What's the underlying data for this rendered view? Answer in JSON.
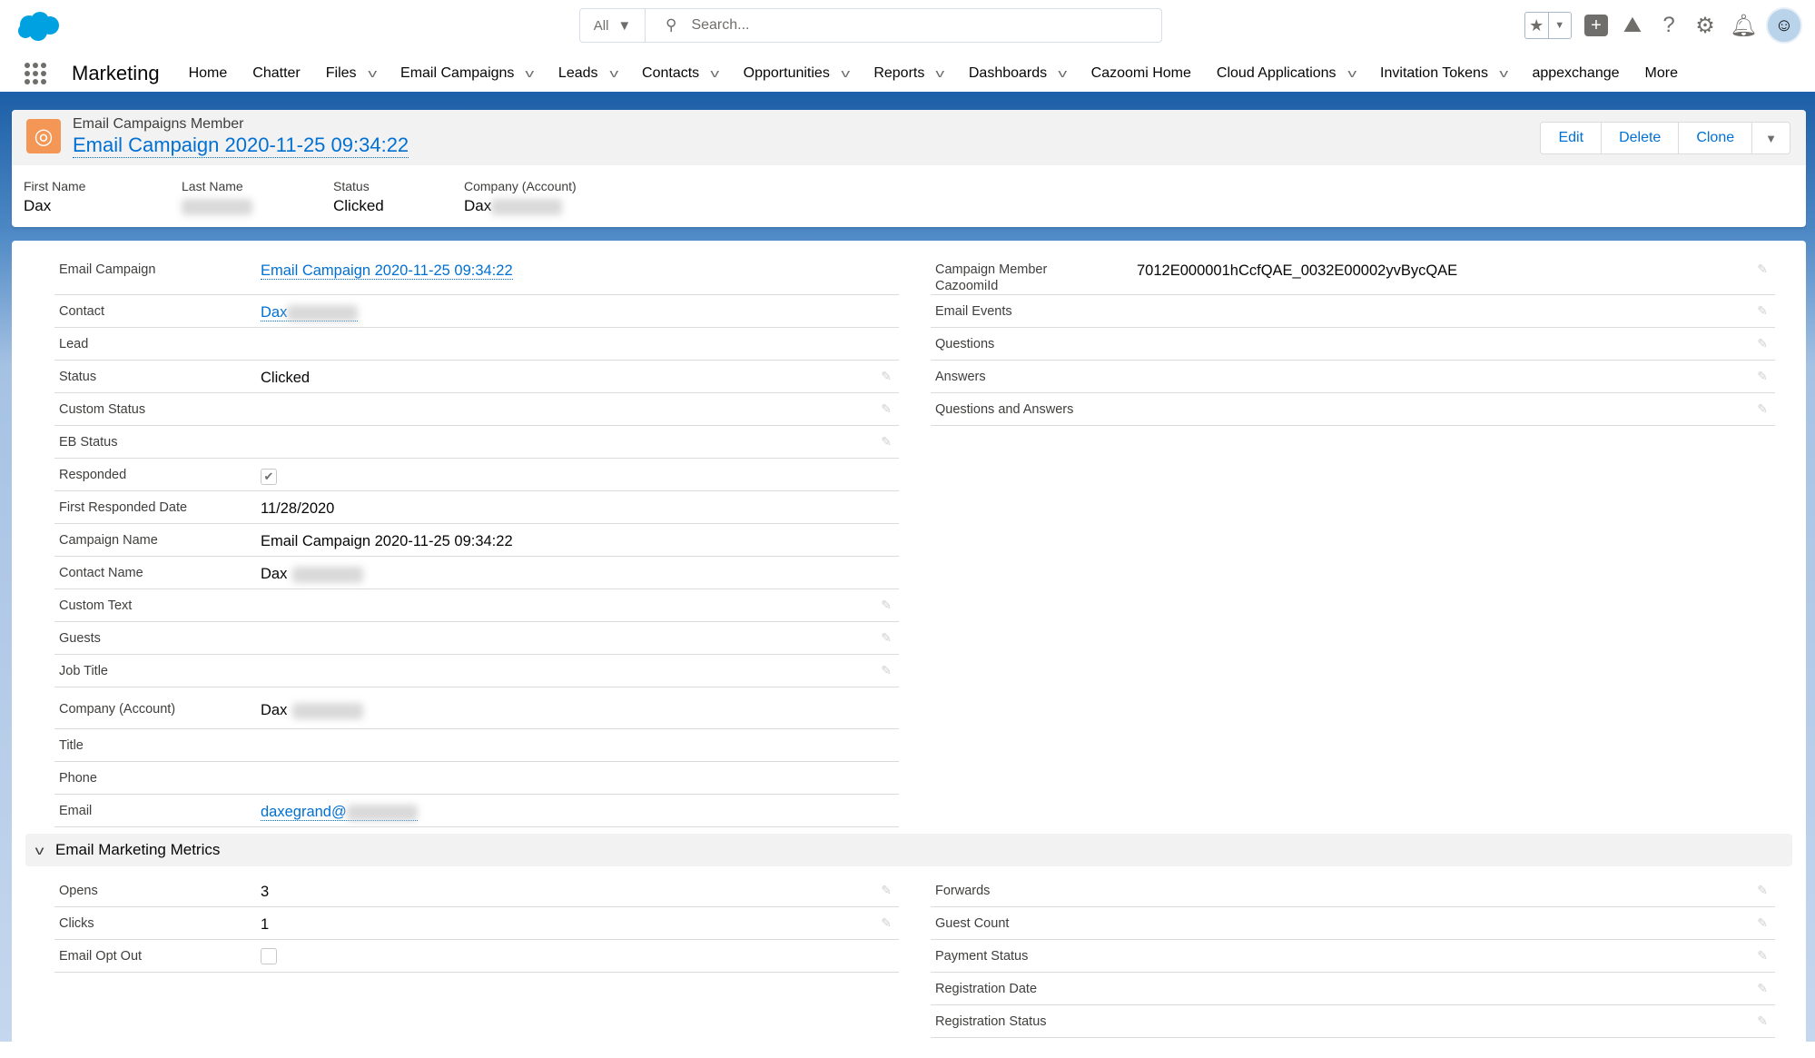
{
  "header": {
    "search_scope": "All",
    "search_placeholder": "Search...",
    "app_name": "Marketing"
  },
  "nav": [
    {
      "label": "Home",
      "menu": false
    },
    {
      "label": "Chatter",
      "menu": false
    },
    {
      "label": "Files",
      "menu": true
    },
    {
      "label": "Email Campaigns",
      "menu": true
    },
    {
      "label": "Leads",
      "menu": true
    },
    {
      "label": "Contacts",
      "menu": true
    },
    {
      "label": "Opportunities",
      "menu": true
    },
    {
      "label": "Reports",
      "menu": true
    },
    {
      "label": "Dashboards",
      "menu": true
    },
    {
      "label": "Cazoomi Home",
      "menu": false
    },
    {
      "label": "Cloud Applications",
      "menu": true
    },
    {
      "label": "Invitation Tokens",
      "menu": true
    },
    {
      "label": "appexchange",
      "menu": false
    },
    {
      "label": "More",
      "menu": false
    }
  ],
  "record": {
    "object_type": "Email Campaigns Member",
    "title": "Email Campaign 2020-11-25 09:34:22",
    "buttons": [
      "Edit",
      "Delete",
      "Clone"
    ]
  },
  "highlights": [
    {
      "label": "First Name",
      "value": "Dax",
      "blur": false
    },
    {
      "label": "Last Name",
      "value": "",
      "blur": true
    },
    {
      "label": "Status",
      "value": "Clicked",
      "blur": false
    },
    {
      "label": "Company (Account)",
      "value": "Dax",
      "blur": true
    }
  ],
  "left_fields": [
    {
      "label": "Email Campaign",
      "value": "Email Campaign 2020-11-25 09:34:22",
      "type": "link"
    },
    {
      "label": "Contact",
      "value": "Dax",
      "type": "link",
      "blur": true
    },
    {
      "label": "Lead",
      "value": ""
    },
    {
      "label": "Status",
      "value": "Clicked",
      "edit": true
    },
    {
      "label": "Custom Status",
      "value": "",
      "edit": true
    },
    {
      "label": "EB Status",
      "value": "",
      "edit": true
    },
    {
      "label": "Responded",
      "type": "checkbox",
      "checked": true
    },
    {
      "label": "First Responded Date",
      "value": "11/28/2020"
    },
    {
      "label": "Campaign Name",
      "value": "Email Campaign 2020-11-25 09:34:22"
    },
    {
      "label": "Contact Name",
      "value": "Dax",
      "blur": true
    },
    {
      "label": "Custom Text",
      "value": "",
      "edit": true
    },
    {
      "label": "Guests",
      "value": "",
      "edit": true
    },
    {
      "label": "Job Title",
      "value": "",
      "edit": true
    },
    {
      "label": "Company (Account)",
      "value": "Dax",
      "blur": true
    },
    {
      "label": "Title",
      "value": ""
    },
    {
      "label": "Phone",
      "value": ""
    },
    {
      "label": "Email",
      "value": "daxegrand@",
      "type": "link",
      "blur": true
    }
  ],
  "right_fields": [
    {
      "label": "Campaign Member CazoomiId",
      "value": "7012E000001hCcfQAE_0032E00002yvBycQAE",
      "edit": true
    },
    {
      "label": "Email Events",
      "value": "",
      "edit": true
    },
    {
      "label": "Questions",
      "value": "",
      "edit": true
    },
    {
      "label": "Answers",
      "value": "",
      "edit": true
    },
    {
      "label": "Questions and Answers",
      "value": "",
      "edit": true
    }
  ],
  "metrics": {
    "title": "Email Marketing Metrics",
    "left": [
      {
        "label": "Opens",
        "value": "3",
        "edit": true
      },
      {
        "label": "Clicks",
        "value": "1",
        "edit": true
      },
      {
        "label": "Email Opt Out",
        "type": "checkbox",
        "checked": false
      }
    ],
    "right": [
      {
        "label": "Forwards",
        "value": "",
        "edit": true
      },
      {
        "label": "Guest Count",
        "value": "",
        "edit": true
      },
      {
        "label": "Payment Status",
        "value": "",
        "edit": true
      },
      {
        "label": "Registration Date",
        "value": "",
        "edit": true
      },
      {
        "label": "Registration Status",
        "value": "",
        "edit": true
      }
    ]
  },
  "colors": {
    "brand": "#00a1e0",
    "link": "#0070d2",
    "record_icon": "#f49756",
    "band": "#1d5fa7"
  }
}
